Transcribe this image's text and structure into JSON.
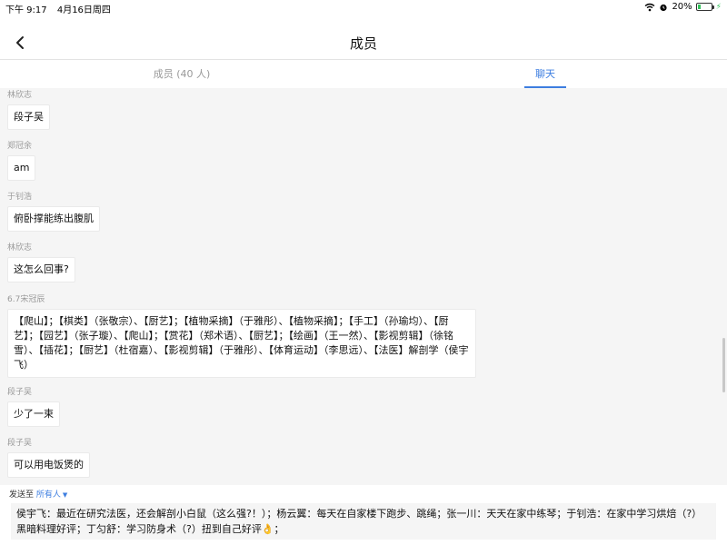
{
  "status_bar": {
    "time": "下午 9:17",
    "date": "4月16日周四",
    "battery": "20%",
    "battery_level": 0.2
  },
  "nav": {
    "title": "成员"
  },
  "tabs": [
    {
      "label": "成员 (40 人)",
      "active": false
    },
    {
      "label": "聊天",
      "active": true
    }
  ],
  "messages": [
    {
      "sender": "林欣志",
      "text": "段子吴"
    },
    {
      "sender": "郑冠余",
      "text": "am"
    },
    {
      "sender": "于钊浩",
      "text": "俯卧撑能练出腹肌"
    },
    {
      "sender": "林欣志",
      "text": "这怎么回事?"
    },
    {
      "sender": "6.7宋冠辰",
      "text": "【爬山】；【棋类】（张敬宗）、【厨艺】；【植物采摘】（于雅彤）、【植物采摘】；【手工】（孙瑜均）、【厨艺】；【园艺】（张子璇）、【爬山】；【赏花】（郑术语）、【厨艺】；【绘画】（王一然）、【影视剪辑】（徐铭雪）、【插花】；【厨艺】（杜宿嘉）、【影视剪辑】（于雅彤）、【体育运动】（李思远）、【法医】解剖学（侯宇飞）"
    },
    {
      "sender": "段子吴",
      "text": "少了一束"
    },
    {
      "sender": "段子吴",
      "text": "可以用电饭煲的"
    }
  ],
  "composer": {
    "send_to_label": "发送至",
    "send_to_target": "所有人",
    "input_text": "侯宇飞：最近在研究法医，还会解剖小白鼠（这么强?！）；杨云翼：每天在自家楼下跑步、跳绳；张一川：天天在家中练琴；于钊浩：在家中学习烘焙（?）黑暗料理好评；丁匀舒：学习防身术（?）扭到自己好评👌；"
  },
  "colors": {
    "accent": "#3d7ee0",
    "battery_green": "#32c25a"
  },
  "icons": [
    "chevron-left-icon",
    "wifi-icon",
    "alarm-icon",
    "battery-icon",
    "caret-down-icon"
  ]
}
